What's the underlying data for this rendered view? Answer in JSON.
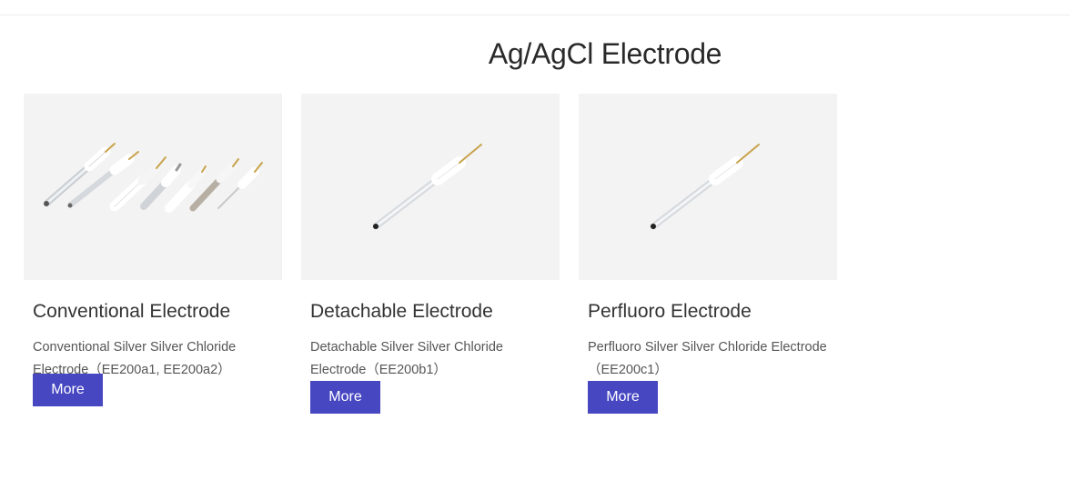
{
  "section": {
    "title": "Ag/AgCl Electrode"
  },
  "products": [
    {
      "title": "Conventional Electrode",
      "description": "Conventional Silver Silver Chloride Electrode（EE200a1, EE200a2）",
      "button_label": "More",
      "image_icon": "electrode-set-icon"
    },
    {
      "title": "Detachable Electrode",
      "description": "Detachable Silver Silver Chloride Electrode（EE200b1）",
      "button_label": "More",
      "image_icon": "single-electrode-icon"
    },
    {
      "title": "Perfluoro Electrode",
      "description": "Perfluoro Silver Silver Chloride Electrode（EE200c1）",
      "button_label": "More",
      "image_icon": "single-electrode-icon"
    }
  ],
  "colors": {
    "button_bg": "#4747c2",
    "image_bg": "#f3f3f3"
  }
}
